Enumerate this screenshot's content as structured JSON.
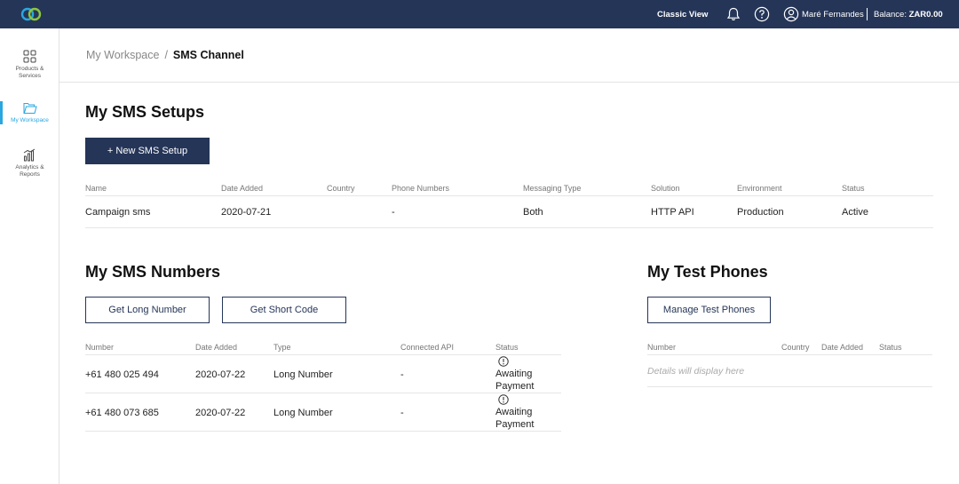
{
  "topbar": {
    "classic_view": "Classic View",
    "user_name": "Maré Fernandes",
    "balance_label": "Balance:",
    "balance_value": "ZAR0.00"
  },
  "sidebar": {
    "items": [
      {
        "label_1": "Products &",
        "label_2": "Services",
        "icon": "grid-icon"
      },
      {
        "label_1": "My Workspace",
        "label_2": "",
        "icon": "folder-icon",
        "active": true
      },
      {
        "label_1": "Analytics &",
        "label_2": "Reports",
        "icon": "chart-icon"
      }
    ],
    "accent": "#2aa7df"
  },
  "breadcrumb": {
    "parent": "My Workspace",
    "separator": "/",
    "current": "SMS Channel"
  },
  "setups": {
    "title": "My SMS Setups",
    "new_button": "+ New SMS Setup",
    "headers": [
      "Name",
      "Date Added",
      "Country",
      "Phone Numbers",
      "Messaging Type",
      "Solution",
      "Environment",
      "Status"
    ],
    "rows": [
      {
        "name": "Campaign sms",
        "date": "2020-07-21",
        "country": "",
        "phone": "-",
        "messaging": "Both",
        "solution": "HTTP API",
        "environment": "Production",
        "status": "Active"
      }
    ]
  },
  "numbers": {
    "title": "My SMS Numbers",
    "long_button": "Get Long Number",
    "short_button": "Get Short Code",
    "headers": [
      "Number",
      "Date Added",
      "Type",
      "Connected API",
      "Status"
    ],
    "rows": [
      {
        "number": "+61 480 025 494",
        "date": "2020-07-22",
        "type": "Long Number",
        "api": "-",
        "status_1": "Awaiting",
        "status_2": "Payment"
      },
      {
        "number": "+61 480 073 685",
        "date": "2020-07-22",
        "type": "Long Number",
        "api": "-",
        "status_1": "Awaiting",
        "status_2": "Payment"
      }
    ]
  },
  "test_phones": {
    "title": "My Test Phones",
    "manage_button": "Manage Test Phones",
    "headers": [
      "Number",
      "Country",
      "Date Added",
      "Status"
    ],
    "empty_text": "Details will display here"
  },
  "colors": {
    "navy": "#253558",
    "accent": "#2aa7df"
  }
}
